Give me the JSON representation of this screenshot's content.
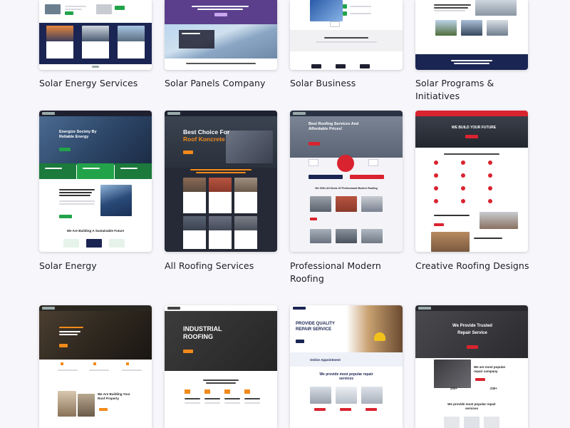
{
  "gallery": {
    "templates": [
      {
        "title": "Solar Energy Services"
      },
      {
        "title": "Solar Panels Company"
      },
      {
        "title": "Solar Business"
      },
      {
        "title": "Solar Programs & Initiatives"
      },
      {
        "title": "Solar Energy"
      },
      {
        "title": "All Roofing Services"
      },
      {
        "title": "Professional Modern Roofing"
      },
      {
        "title": "Creative Roofing Designs"
      },
      {
        "title": "",
        "hero": "",
        "sub": "We Are Building Your Roof Property"
      },
      {
        "title": "",
        "hero": "INDUSTRIAL ROOFING"
      },
      {
        "title": "",
        "hero": "PROVIDE QUALITY REPAIR SERVICE",
        "sub": "We provide most popular repair services"
      },
      {
        "title": "",
        "hero": "We Provide Trusted Repair Service",
        "sub": "We are most popular repair company"
      }
    ]
  },
  "thumb_text": {
    "t5_hero": "Energize Society By Reliable Energy",
    "t5_sub": "We Are Building A Sustainable Future",
    "t6_hero_1": "Best Choice For",
    "t6_hero_2": "Roof Koncrete",
    "t7_hero": "Best Roofing Services And Affordable Prices!",
    "t7_sub": "We Offer All Kinds Of Professional Modern Roofing",
    "t8_hero": "WE BUILD YOUR FUTURE",
    "t11_cta": "Online Appointment",
    "t12_stat1": "200+",
    "t12_stat2": "230+"
  },
  "colors": {
    "navy": "#1b2553",
    "purple": "#5b3f8c",
    "green": "#22a34a",
    "red": "#d9232f",
    "orange": "#f28a1a",
    "dark": "#262a36"
  }
}
